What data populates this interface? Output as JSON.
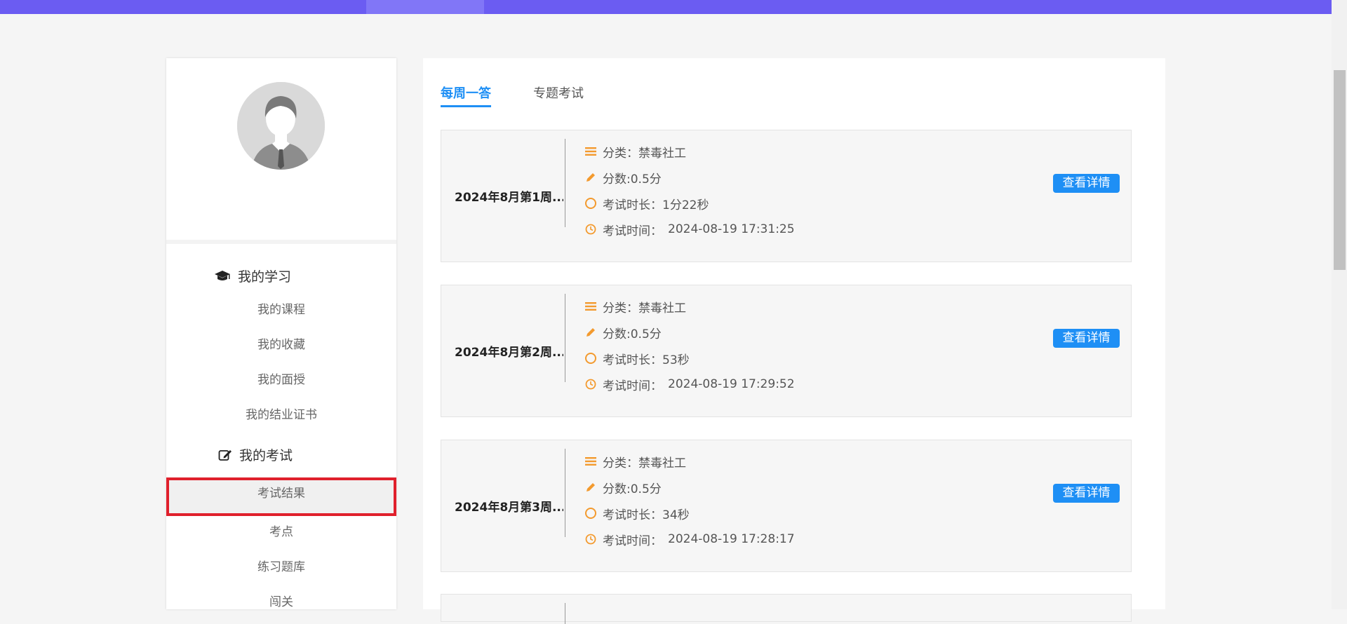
{
  "tabs": [
    {
      "label": "每周一答",
      "active": true
    },
    {
      "label": "专题考试",
      "active": false
    }
  ],
  "sidebar": {
    "groups": [
      {
        "title": "我的学习",
        "icon": "graduation-cap-icon",
        "items": [
          "我的课程",
          "我的收藏",
          "我的面授",
          "我的结业证书"
        ]
      },
      {
        "title": "我的考试",
        "icon": "edit-icon",
        "items": [
          "考试结果",
          "考点",
          "练习题库",
          "闯关"
        ]
      }
    ],
    "selected_item": "考试结果"
  },
  "labels": {
    "category": "分类：",
    "score": "分数:",
    "duration": "考试时长：",
    "time": "考试时间：",
    "detail_button": "查看详情"
  },
  "records": [
    {
      "title": "2024年8月第1周...",
      "category": "禁毒社工",
      "score": "0.5分",
      "duration": "1分22秒",
      "time": "2024-08-19 17:31:25"
    },
    {
      "title": "2024年8月第2周...",
      "category": "禁毒社工",
      "score": "0.5分",
      "duration": "53秒",
      "time": "2024-08-19 17:29:52"
    },
    {
      "title": "2024年8月第3周...",
      "category": "禁毒社工",
      "score": "0.5分",
      "duration": "34秒",
      "time": "2024-08-19 17:28:17"
    }
  ],
  "colors": {
    "accent": "#1e8ff5",
    "topbar": "#6b5cf2",
    "icon_orange": "#f39a2e",
    "highlight_border": "#e0202c"
  }
}
